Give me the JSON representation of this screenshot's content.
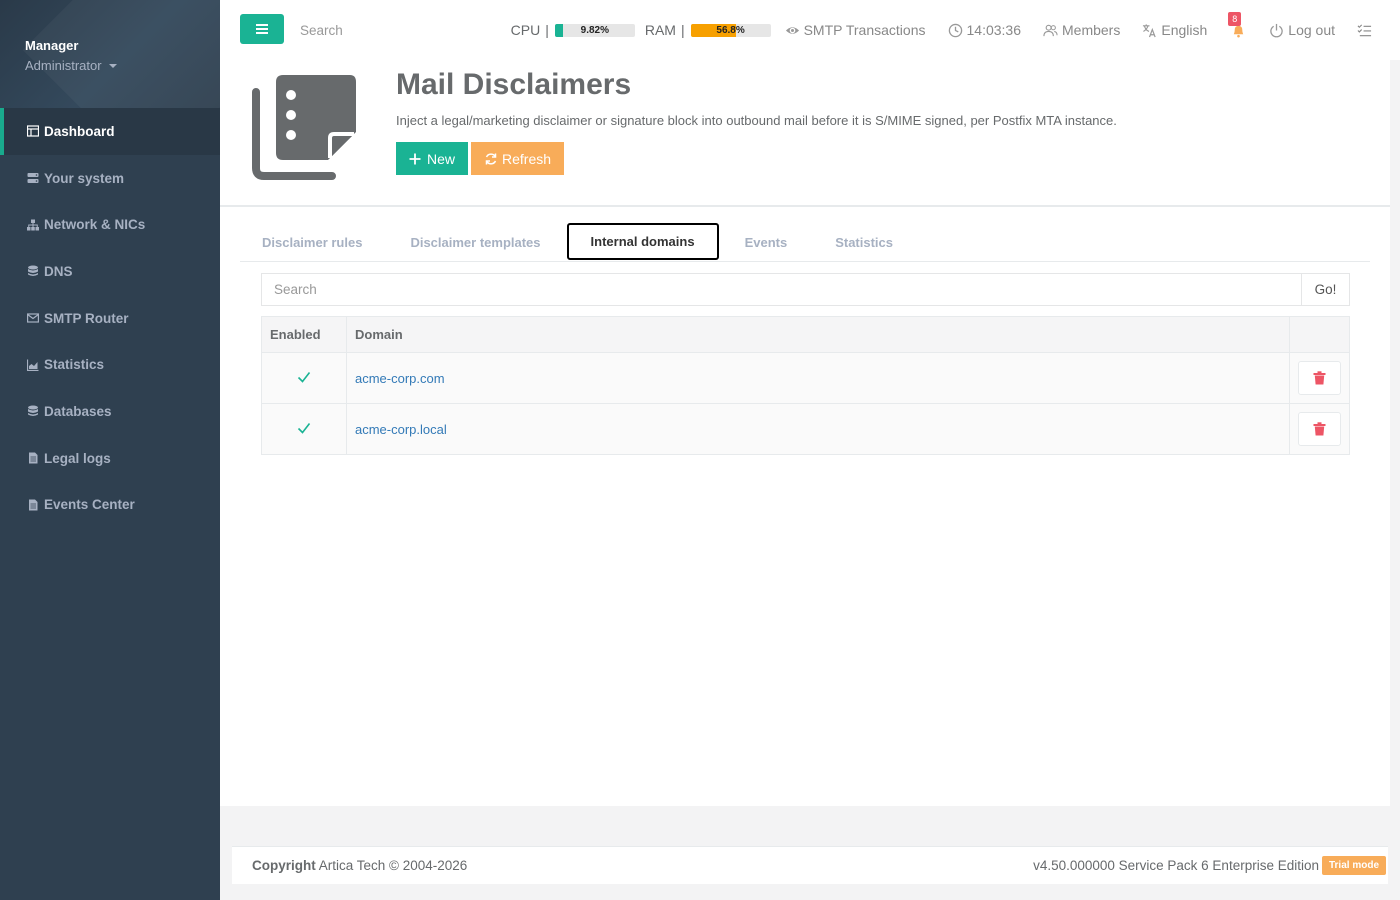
{
  "sidebar": {
    "profile_name": "Manager",
    "profile_role": "Administrator",
    "items": [
      {
        "label": "Dashboard",
        "icon": "dashboard-icon",
        "active": true
      },
      {
        "label": "Your system",
        "icon": "server-icon"
      },
      {
        "label": "Network & NICs",
        "icon": "network-icon"
      },
      {
        "label": "DNS",
        "icon": "database-icon"
      },
      {
        "label": "SMTP Router",
        "icon": "envelope-icon"
      },
      {
        "label": "Statistics",
        "icon": "chart-icon"
      },
      {
        "label": "Databases",
        "icon": "database-icon"
      },
      {
        "label": "Legal logs",
        "icon": "file-icon"
      },
      {
        "label": "Events Center",
        "icon": "file-icon"
      }
    ]
  },
  "topbar": {
    "search_placeholder": "Search",
    "cpu_label": "CPU",
    "cpu_text": "9.82%",
    "cpu_value": 9.82,
    "cpu_color": "#1ab394",
    "ram_label": "RAM",
    "ram_text": "56.8%",
    "ram_value": 56.8,
    "ram_color": "#f7a000",
    "separator": "|",
    "smtp_label": "SMTP Transactions",
    "clock": "14:03:36",
    "members_label": "Members",
    "language_label": "English",
    "notifications_count": "8",
    "logout_label": "Log out"
  },
  "header": {
    "title": "Mail Disclaimers",
    "description": "Inject a legal/marketing disclaimer or signature block into outbound mail before it is S/MIME signed, per Postfix MTA instance.",
    "new_label": "New",
    "refresh_label": "Refresh"
  },
  "tabs": [
    {
      "label": "Disclaimer rules"
    },
    {
      "label": "Disclaimer templates"
    },
    {
      "label": "Internal domains",
      "active": true
    },
    {
      "label": "Events"
    },
    {
      "label": "Statistics"
    }
  ],
  "search": {
    "placeholder": "Search",
    "go_label": "Go!"
  },
  "table": {
    "columns": [
      "Enabled",
      "Domain",
      ""
    ],
    "rows": [
      {
        "enabled": true,
        "domain": "acme-corp.com"
      },
      {
        "enabled": true,
        "domain": "acme-corp.local"
      }
    ]
  },
  "footer": {
    "copyright_bold": "Copyright",
    "copyright_text": "Artica Tech © 2004-2026",
    "version": "v4.50.000000 Service Pack 6 Enterprise Edition",
    "trial_label": "Trial mode"
  },
  "colors": {
    "sidebar_bg": "#2f4050",
    "accent_green": "#1ab394",
    "accent_orange": "#f8ac59",
    "danger": "#ed5565",
    "link": "#337ab7"
  }
}
